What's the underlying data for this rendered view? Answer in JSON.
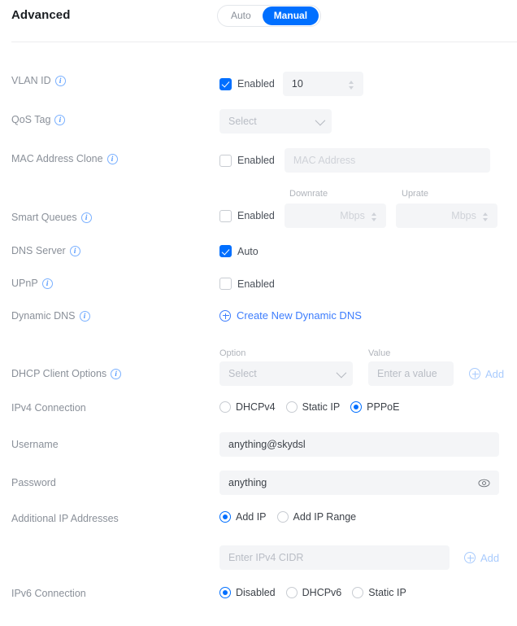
{
  "header": {
    "title": "Advanced",
    "mode_toggle": {
      "options": [
        "Auto",
        "Manual"
      ],
      "selected": "Manual"
    }
  },
  "colors": {
    "accent": "#006fff",
    "link": "#3d7dfd",
    "label": "#8a9099",
    "field_bg": "#f4f5f7",
    "placeholder": "#b9bdc5",
    "divider": "#ececee"
  },
  "rows": {
    "vlan": {
      "label": "VLAN ID",
      "has_info": true,
      "checkbox_label": "Enabled",
      "checked": true,
      "value": "10"
    },
    "qos": {
      "label": "QoS Tag",
      "has_info": true,
      "select_placeholder": "Select"
    },
    "mac_clone": {
      "label": "MAC Address Clone",
      "has_info": true,
      "checkbox_label": "Enabled",
      "checked": false,
      "input_placeholder": "MAC Address"
    },
    "smart_queues": {
      "label": "Smart Queues",
      "has_info": true,
      "checkbox_label": "Enabled",
      "checked": false,
      "downrate_label": "Downrate",
      "downrate_placeholder": "Mbps",
      "uprate_label": "Uprate",
      "uprate_placeholder": "Mbps"
    },
    "dns_server": {
      "label": "DNS Server",
      "has_info": true,
      "checkbox_label": "Auto",
      "checked": true
    },
    "upnp": {
      "label": "UPnP",
      "has_info": true,
      "checkbox_label": "Enabled",
      "checked": false
    },
    "dynamic_dns": {
      "label": "Dynamic DNS",
      "has_info": true,
      "link_label": "Create New Dynamic DNS"
    },
    "dhcp_client_options": {
      "label": "DHCP Client Options",
      "has_info": true,
      "option_label": "Option",
      "option_placeholder": "Select",
      "value_label": "Value",
      "value_placeholder": "Enter a value",
      "add_label": "Add"
    },
    "ipv4_connection": {
      "label": "IPv4 Connection",
      "has_info": false,
      "options": [
        "DHCPv4",
        "Static IP",
        "PPPoE"
      ],
      "selected": "PPPoE"
    },
    "username": {
      "label": "Username",
      "has_info": false,
      "value": "anything@skydsl"
    },
    "password": {
      "label": "Password",
      "has_info": false,
      "value": "anything",
      "reveal_icon": "eye-icon"
    },
    "additional_ip": {
      "label": "Additional IP Addresses",
      "has_info": false,
      "options": [
        "Add IP",
        "Add IP Range"
      ],
      "selected": "Add IP",
      "cidr_placeholder": "Enter IPv4 CIDR",
      "add_label": "Add"
    },
    "ipv6_connection": {
      "label": "IPv6 Connection",
      "has_info": false,
      "options": [
        "Disabled",
        "DHCPv6",
        "Static IP"
      ],
      "selected": "Disabled"
    }
  }
}
